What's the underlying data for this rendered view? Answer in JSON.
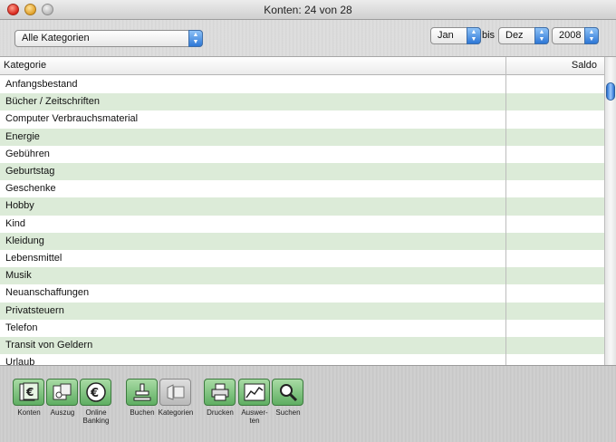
{
  "window": {
    "title": "Konten: 24 von 28"
  },
  "filters": {
    "category_popup": "Alle Kategorien",
    "from_month": "Jan",
    "range_separator": "bis",
    "to_month": "Dez",
    "year": "2008"
  },
  "table": {
    "columns": {
      "category": "Kategorie",
      "balance": "Saldo"
    },
    "rows": [
      "Anfangsbestand",
      "Bücher / Zeitschriften",
      "Computer Verbrauchsmaterial",
      "Energie",
      "Gebühren",
      "Geburtstag",
      "Geschenke",
      "Hobby",
      "Kind",
      "Kleidung",
      "Lebensmittel",
      "Musik",
      "Neuanschaffungen",
      "Privatsteuern",
      "Telefon",
      "Transit von Geldern",
      "Urlaub"
    ]
  },
  "toolbar": {
    "buttons": [
      {
        "label": "Konten",
        "icon": "accounts-icon"
      },
      {
        "label": "Auszug",
        "icon": "statement-icon"
      },
      {
        "label": "Online Banking",
        "icon": "online-banking-icon"
      },
      {
        "label": "Buchen",
        "icon": "stamp-icon"
      },
      {
        "label": "Kategorien",
        "icon": "categories-icon"
      },
      {
        "label": "Drucken",
        "icon": "printer-icon"
      },
      {
        "label": "Auswer-ten",
        "icon": "chart-icon"
      },
      {
        "label": "Suchen",
        "icon": "magnifier-icon"
      }
    ]
  },
  "colors": {
    "row_stripe": "#dcebd8",
    "button_green": "#5fae62",
    "accent_blue": "#2d77d6"
  }
}
